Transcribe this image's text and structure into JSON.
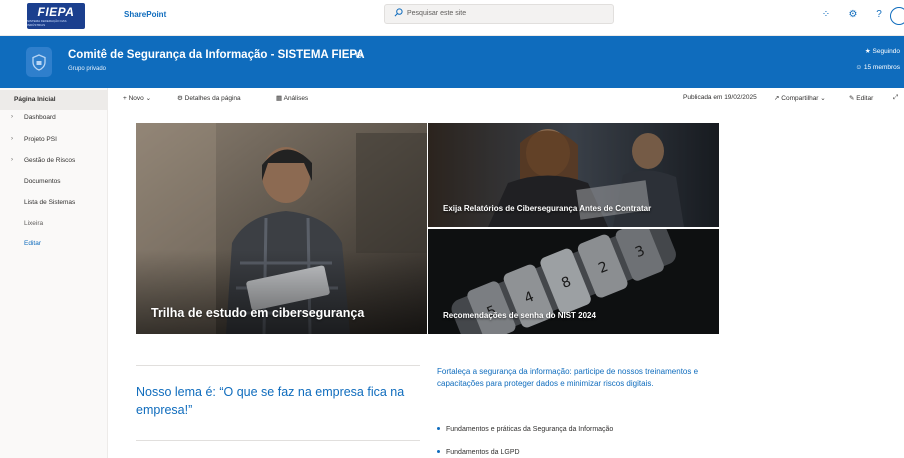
{
  "suite": {
    "logo_text": "FIEPA",
    "logo_subtext": "SISTEMA FEDERAÇÃO DAS INDÚSTRIAS",
    "app_name": "SharePoint",
    "search_placeholder": "Pesquisar este site"
  },
  "site": {
    "title": "Comitê de Segurança da Informação - SISTEMA FIEPA",
    "subtitle": "Grupo privado",
    "follow_label": "Seguindo",
    "members_label": "15 membros"
  },
  "nav": {
    "home": "Página Inicial",
    "items": [
      "Dashboard",
      "Projeto PSI",
      "Gestão de Riscos",
      "Documentos",
      "Lista de Sistemas",
      "Lixeira",
      "Editar"
    ]
  },
  "commandbar": {
    "new_label": "Novo",
    "page_details_label": "Detalhes da página",
    "analytics_label": "Análises",
    "published_label": "Publicada em 19/02/2025",
    "share_label": "Compartilhar",
    "edit_label": "Editar"
  },
  "hero": {
    "main_caption": "Trilha de estudo em cibersegurança",
    "top_right_caption": "Exija Relatórios de Cibersegurança Antes de Contratar",
    "bottom_right_caption": "Recomendações de senha do NIST 2024"
  },
  "content": {
    "motto": "Nosso lema é: “O que se faz na empresa fica na empresa!”",
    "intro": "Fortaleça a segurança da informação: participe de nossos treinamentos e capacitações para proteger dados e minimizar riscos digitais.",
    "links": [
      "Fundamentos e práticas da Segurança da Informação",
      "Fundamentos da LGPD"
    ]
  },
  "colors": {
    "brand": "#0f6cbd",
    "logo_blue": "#1b3f8e"
  },
  "icons": {
    "search": "search-icon",
    "follow": "star-icon",
    "members": "people-icon",
    "settings": "gear-icon",
    "help": "help-icon"
  }
}
